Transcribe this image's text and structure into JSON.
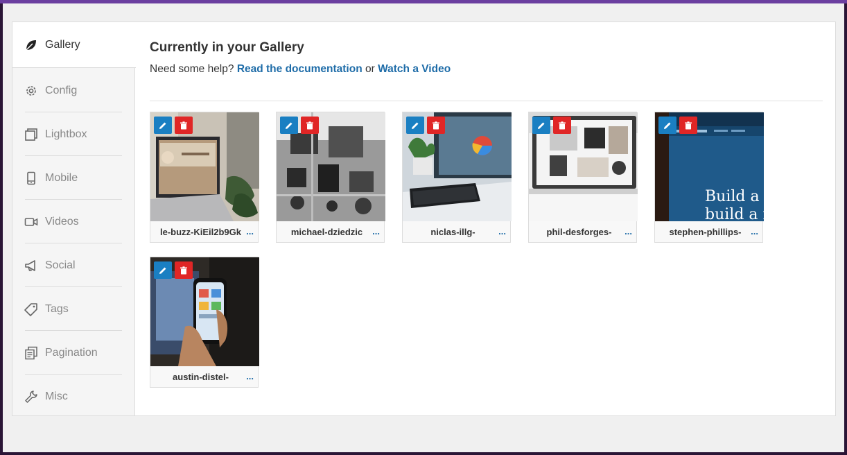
{
  "sidebar": {
    "items": [
      {
        "label": "Gallery",
        "icon": "leaf-icon",
        "active": true
      },
      {
        "label": "Config",
        "icon": "gear-icon"
      },
      {
        "label": "Lightbox",
        "icon": "lightbox-icon"
      },
      {
        "label": "Mobile",
        "icon": "mobile-icon"
      },
      {
        "label": "Videos",
        "icon": "video-icon"
      },
      {
        "label": "Social",
        "icon": "megaphone-icon"
      },
      {
        "label": "Tags",
        "icon": "tag-icon"
      },
      {
        "label": "Pagination",
        "icon": "pagination-icon"
      },
      {
        "label": "Misc",
        "icon": "wrench-icon"
      }
    ]
  },
  "main": {
    "title": "Currently in your Gallery",
    "help_prefix": "Need some help?",
    "help_link1": "Read the documentation",
    "help_or": "or",
    "help_link2": "Watch a Video"
  },
  "gallery": {
    "more_label": "...",
    "items": [
      {
        "name": "le-buzz-KiEil2b9Gk"
      },
      {
        "name": "michael-dziedzic"
      },
      {
        "name": "niclas-illg-"
      },
      {
        "name": "phil-desforges-"
      },
      {
        "name": "stephen-phillips-",
        "image_text": "Build a v\nbuild a n"
      },
      {
        "name": "austin-distel-"
      }
    ]
  },
  "colors": {
    "accent": "#1e6ca8",
    "edit": "#1a7fc2",
    "delete": "#e02626",
    "topbar": "#6b3fa0"
  }
}
